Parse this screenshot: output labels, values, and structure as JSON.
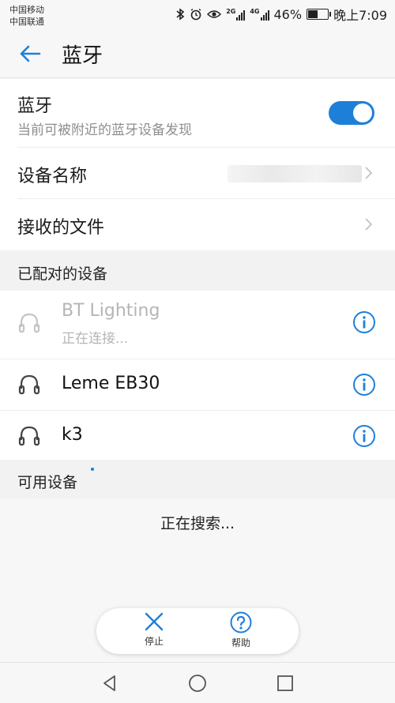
{
  "status_bar": {
    "carrier_1": "中国移动",
    "carrier_2": "中国联通",
    "network_1": "2G",
    "network_2": "4G",
    "battery": "46%",
    "battery_level": 0.46,
    "time": "晚上7:09",
    "icons": [
      "bluetooth-icon",
      "alarm-icon",
      "eye-icon",
      "signal-icon",
      "battery-icon"
    ]
  },
  "header": {
    "back_icon": "arrow-left-icon",
    "title": "蓝牙"
  },
  "bluetooth": {
    "label": "蓝牙",
    "subtitle": "当前可被附近的蓝牙设备发现",
    "enabled": true
  },
  "settings": {
    "device_name_label": "设备名称",
    "received_files_label": "接收的文件"
  },
  "paired": {
    "header": "已配对的设备",
    "devices": [
      {
        "name": "BT Lighting",
        "status": "正在连接...",
        "icon": "headset-icon"
      },
      {
        "name": "Leme EB30",
        "status": "",
        "icon": "headset-icon"
      },
      {
        "name": "k3",
        "status": "",
        "icon": "headset-icon"
      }
    ]
  },
  "available": {
    "header": "可用设备",
    "searching": "正在搜索..."
  },
  "actions": {
    "stop_label": "停止",
    "help_label": "帮助"
  },
  "colors": {
    "accent": "#1e7fd9",
    "background": "#f7f7f7",
    "card": "#ffffff",
    "section": "#f2f2f2",
    "disabled": "#b5b5b5"
  }
}
